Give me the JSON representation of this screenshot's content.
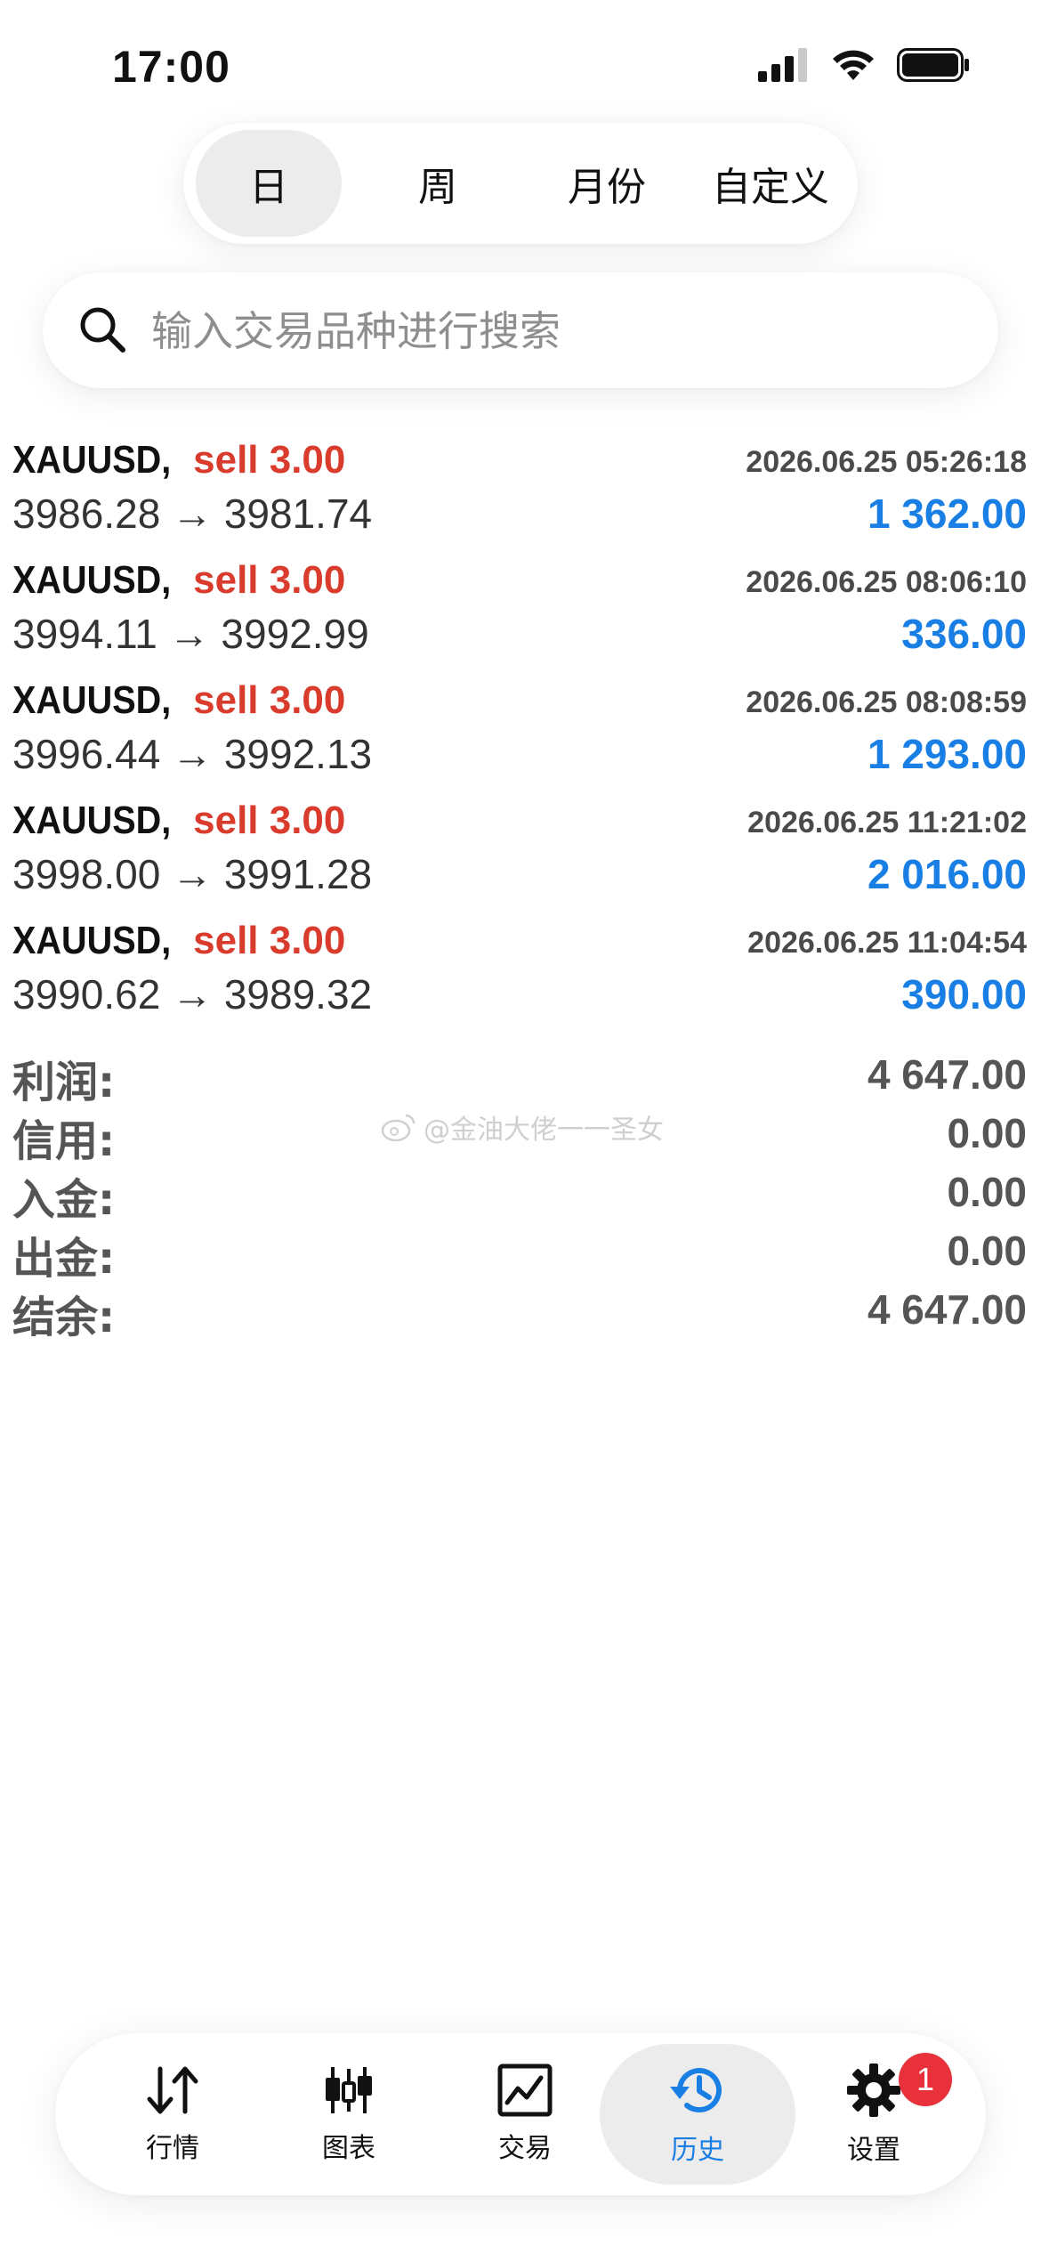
{
  "status_bar": {
    "time": "17:00",
    "icons": [
      "signal-icon",
      "wifi-icon",
      "battery-icon"
    ]
  },
  "period_tabs": [
    {
      "label": "日",
      "active": true
    },
    {
      "label": "周",
      "active": false
    },
    {
      "label": "月份",
      "active": false
    },
    {
      "label": "自定义",
      "active": false
    }
  ],
  "search": {
    "placeholder": "输入交易品种进行搜索",
    "icon": "search-icon"
  },
  "deals": [
    {
      "symbol": "XAUUSD,",
      "side": "sell 3.00",
      "time": "2026.06.25 05:26:18",
      "prices": "3986.28 → 3981.74",
      "profit": "1 362.00"
    },
    {
      "symbol": "XAUUSD,",
      "side": "sell 3.00",
      "time": "2026.06.25 08:06:10",
      "prices": "3994.11 → 3992.99",
      "profit": "336.00"
    },
    {
      "symbol": "XAUUSD,",
      "side": "sell 3.00",
      "time": "2026.06.25 08:08:59",
      "prices": "3996.44 → 3992.13",
      "profit": "1 293.00"
    },
    {
      "symbol": "XAUUSD,",
      "side": "sell 3.00",
      "time": "2026.06.25 11:21:02",
      "prices": "3998.00 → 3991.28",
      "profit": "2 016.00"
    },
    {
      "symbol": "XAUUSD,",
      "side": "sell 3.00",
      "time": "2026.06.25 11:04:54",
      "prices": "3990.62 → 3989.32",
      "profit": "390.00"
    }
  ],
  "summary": [
    {
      "label": "利润:",
      "value": "4 647.00"
    },
    {
      "label": "信用:",
      "value": "0.00"
    },
    {
      "label": "入金:",
      "value": "0.00"
    },
    {
      "label": "出金:",
      "value": "0.00"
    },
    {
      "label": "结余:",
      "value": "4 647.00"
    }
  ],
  "watermark": "@金油大佬一一圣女",
  "bottom_nav": [
    {
      "label": "行情",
      "icon": "arrows-up-down-icon",
      "active": false
    },
    {
      "label": "图表",
      "icon": "candlestick-icon",
      "active": false
    },
    {
      "label": "交易",
      "icon": "trade-chart-icon",
      "active": false
    },
    {
      "label": "历史",
      "icon": "history-clock-icon",
      "active": true
    },
    {
      "label": "设置",
      "icon": "gear-icon",
      "active": false,
      "badge": "1"
    }
  ],
  "colors": {
    "sell": "#d93b2c",
    "profit": "#1a7fe4",
    "active_nav": "#1a7fe4",
    "badge": "#e8313a"
  }
}
